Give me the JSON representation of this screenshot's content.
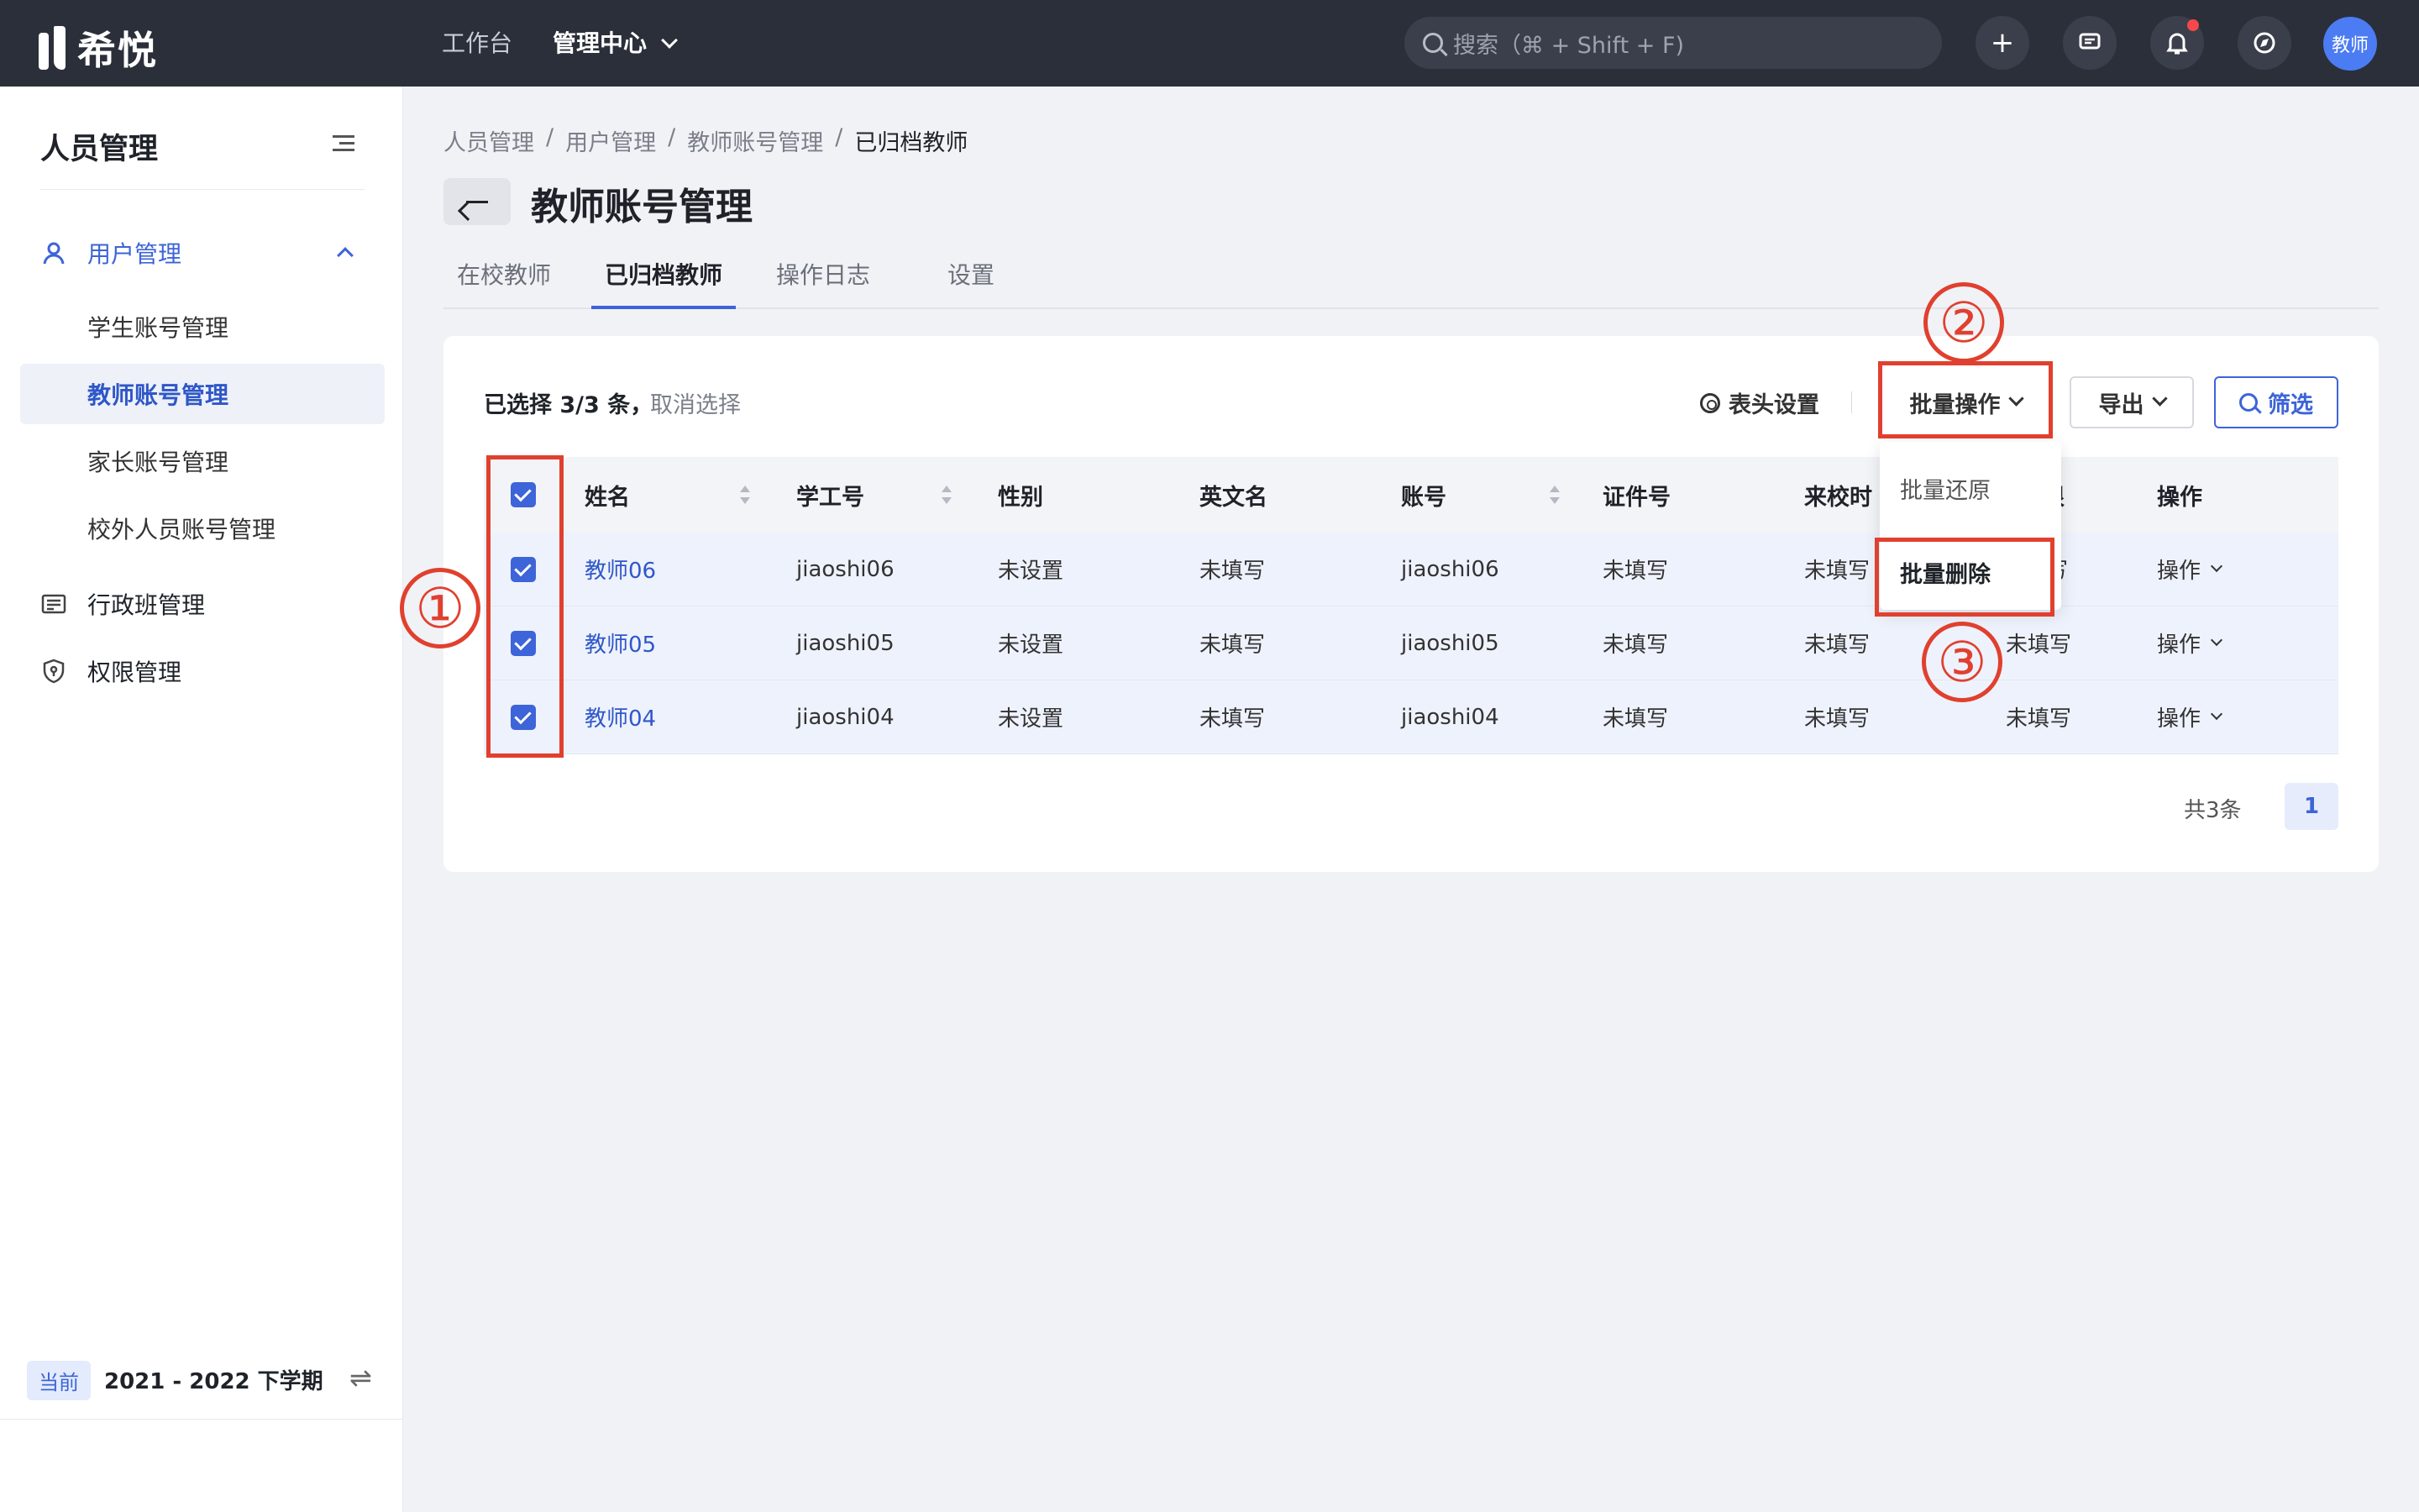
{
  "topbar": {
    "brand": "希悦",
    "nav": [
      "工作台",
      "管理中心"
    ],
    "search_placeholder": "搜索（⌘ + Shift + F)",
    "avatar_label": "教师"
  },
  "sidebar": {
    "title": "人员管理",
    "group_label": "用户管理",
    "sub_items": [
      "学生账号管理",
      "教师账号管理",
      "家长账号管理",
      "校外人员账号管理"
    ],
    "items": [
      "行政班管理",
      "权限管理"
    ],
    "term_badge": "当前",
    "term": "2021 - 2022 下学期"
  },
  "breadcrumb": [
    "人员管理",
    "用户管理",
    "教师账号管理",
    "已归档教师"
  ],
  "page_title": "教师账号管理",
  "tabs": [
    "在校教师",
    "已归档教师",
    "操作日志",
    "设置"
  ],
  "toolbar": {
    "selected_text": "已选择 3/3 条，",
    "cancel_selection": "取消选择",
    "header_settings": "表头设置",
    "batch_ops": "批量操作",
    "export": "导出",
    "filter": "筛选"
  },
  "dropdown": [
    "批量还原",
    "批量删除"
  ],
  "table": {
    "headers": [
      "姓名",
      "学工号",
      "性别",
      "英文名",
      "账号",
      "证件号",
      "来校时",
      "年限",
      "操作"
    ],
    "rows": [
      {
        "name": "教师06",
        "id": "jiaoshi06",
        "gender": "未设置",
        "en": "未填写",
        "account": "jiaoshi06",
        "cert": "未填写",
        "date": "未填写",
        "years": "写",
        "op": "操作"
      },
      {
        "name": "教师05",
        "id": "jiaoshi05",
        "gender": "未设置",
        "en": "未填写",
        "account": "jiaoshi05",
        "cert": "未填写",
        "date": "未填写",
        "years": "未填写",
        "op": "操作"
      },
      {
        "name": "教师04",
        "id": "jiaoshi04",
        "gender": "未设置",
        "en": "未填写",
        "account": "jiaoshi04",
        "cert": "未填写",
        "date": "未填写",
        "years": "未填写",
        "op": "操作"
      }
    ]
  },
  "pagination": {
    "total": "共3条",
    "current": "1"
  },
  "annotations": [
    "①",
    "②",
    "③"
  ],
  "colors": {
    "accent": "#3d64d8",
    "annotation": "#e0402f",
    "topbar": "#2b2f3a"
  }
}
